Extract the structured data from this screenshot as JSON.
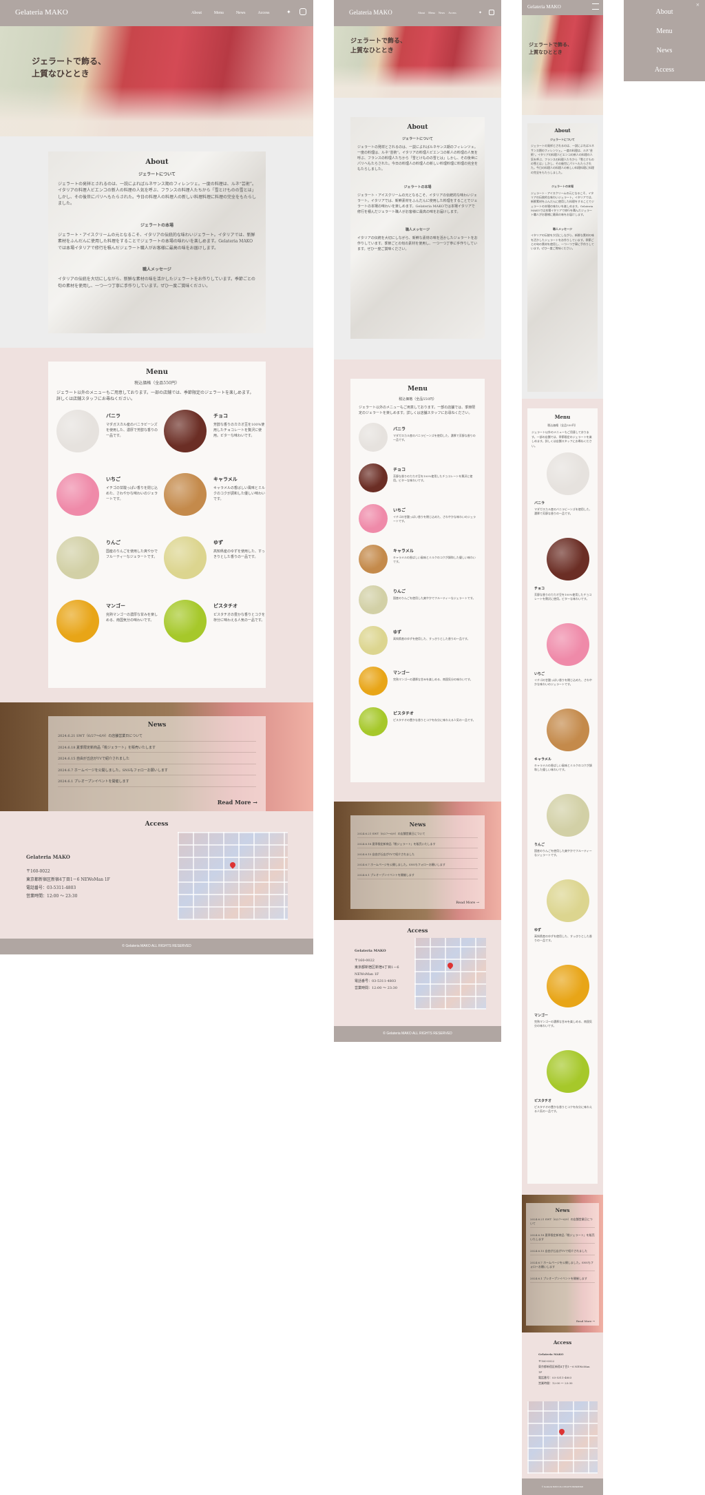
{
  "brand": "Gelateria MAKO",
  "nav": {
    "about": "About",
    "menu": "Menu",
    "news": "News",
    "access": "Access"
  },
  "hero": {
    "line1": "ジェラートで飾る、",
    "line2": "上質なひととき"
  },
  "about": {
    "title": "About",
    "h1": "ジェラートについて",
    "p1": "ジェラートの発祥とされるのは、一説によればルネサンス期のフィレンツェ。一度の料理は、ルネ“芸術”。イタリアの料理人ビエンコの新人の料理の人気を呼ぶ、フランスの料理人たちから「雪とけものの雪とは」しかし、その後世にパリへもたらされた。今日の料理人の料理人の新しい料理料理に料理の完全をもたらしました。",
    "h2": "ジェラートの本場",
    "p2": "ジェラート・アイスクリームの元となるこそ、イタリアの伝統的な味わいジェラート。イタリアでは、新鮮素材をふんだんに使用した料理をすることでジェラートの本場の味わいを楽しめます。Gelateria MAKOでは本場イタリアで修行を積んだジェラート職人がお客様に最高の味をお届けします。",
    "h3": "職人メッセージ",
    "p3": "イタリアの伝統を大切にしながら、新鮮な素材の味を活かしたジェラートをお作りしています。季節ごとの旬の素材を使用し、一つ一つ丁寧に手作りしています。ぜひ一度ご賞味ください。"
  },
  "menu": {
    "title": "Menu",
    "price": "税込価格（全品550円）",
    "intro": "ジェラート以外のメニューもご用意しております。一部の店舗では、季節限定のジェラートを楽しめます。詳しくは店舗スタッフにお尋ねください。",
    "items": [
      {
        "name": "バニラ",
        "desc": "マダガスカル産のバニラビーンズを使用した、濃厚で芳醇な香りの一品です。",
        "color": "#e6e2de"
      },
      {
        "name": "チョコ",
        "desc": "芳醇な香りのカカオ豆を100%使用したチョコレートを贅沢に使用。ビターな味わいです。",
        "color": "#6b2e25"
      },
      {
        "name": "いちご",
        "desc": "イチゴの甘酸っぱい香りを閉じ込めた、さわやかな味わいのジェラートです。",
        "color": "#ef8aa9"
      },
      {
        "name": "キャラメル",
        "desc": "キャラメルの香ばしい風味とミルクのコクが調和した優しい味わいです。",
        "color": "#c48a4b"
      },
      {
        "name": "りんご",
        "desc": "国産のりんごを使用した爽やかでフルーティーなジェラートです。",
        "color": "#d2d0a6"
      },
      {
        "name": "ゆず",
        "desc": "高知県産のゆずを使用した、すっきりとした香りの一品です。",
        "color": "#dcd58f"
      },
      {
        "name": "マンゴー",
        "desc": "完熟マンゴーの濃厚な甘みを楽しめる、南国気分の味わいです。",
        "color": "#e8a517"
      },
      {
        "name": "ピスタチオ",
        "desc": "ピスタチオの豊かな香りとコクを存分に味わえる人気の一品です。",
        "color": "#a6c82a"
      }
    ]
  },
  "news": {
    "title": "News",
    "items": [
      "2024.6.21 SWT（6/27〜6/9）の店舗営業日について",
      "2024.6.18 夏季限定新商品「桃ジェラート」を販売いたします",
      "2024.6.15 自由が丘店がTVで紹介されました",
      "2024.6.7 ホームページを公開しました。SNSもフォローお願いします",
      "2024.6.1 プレオープンイベントを開催します"
    ],
    "read_more": "Read More →"
  },
  "access": {
    "title": "Access",
    "name": "Gelateria MAKO",
    "postal": "〒160-0022",
    "address": "東京都新宿区新宿4丁目1－6 NEWoMan 1F",
    "tel": "電話番号：03-5311-4803",
    "hours": "営業時間：12:00 ～ 23:30"
  },
  "footer": "© Gelateria MAKO ALL RIGHTS RESERVED",
  "mobile_menu": {
    "close": "×",
    "about": "About",
    "menu": "Menu",
    "news": "News",
    "access": "Access"
  }
}
